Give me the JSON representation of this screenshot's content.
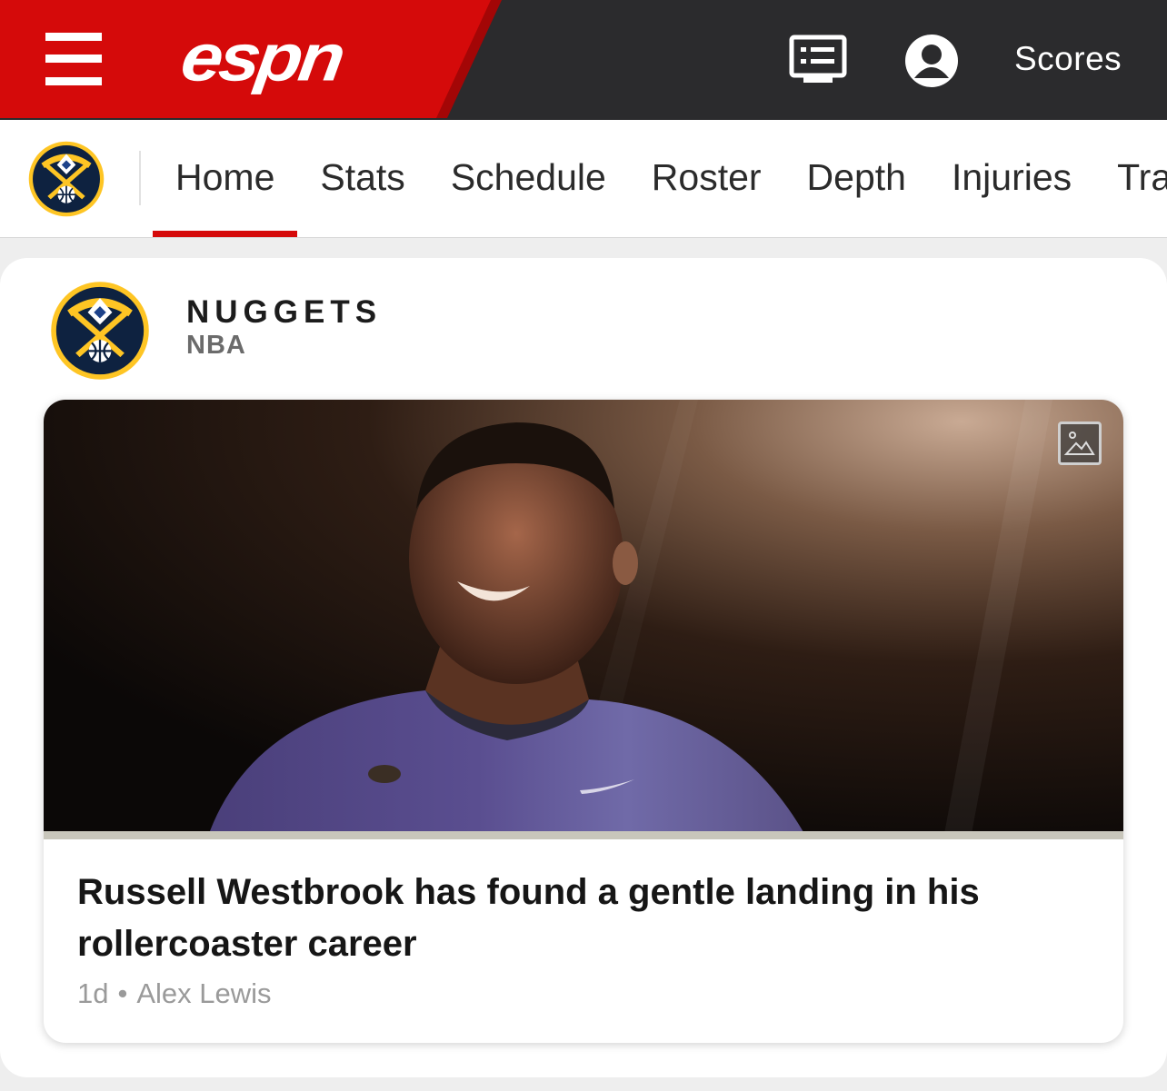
{
  "topbar": {
    "brand": "espn",
    "scores_label": "Scores",
    "icons": {
      "menu": "hamburger-menu-icon",
      "watch": "watch-list-icon",
      "profile": "profile-icon"
    },
    "colors": {
      "brand_red": "#d50a0a",
      "bar_dark": "#2b2b2d"
    }
  },
  "team_nav": {
    "tabs": [
      "Home",
      "Stats",
      "Schedule",
      "Roster",
      "Depth",
      "Injuries",
      "Transactions"
    ],
    "active_tab": "Home"
  },
  "team": {
    "name": "NUGGETS",
    "league": "NBA",
    "colors": {
      "navy": "#0e2240",
      "gold": "#fec524",
      "red": "#8b2131",
      "blue": "#1d428a"
    }
  },
  "story": {
    "headline": "Russell Westbrook has found a gentle landing in his rollercoaster career",
    "age": "1d",
    "separator": "•",
    "author": "Alex Lewis",
    "media_icon": "photo-gallery-icon"
  }
}
